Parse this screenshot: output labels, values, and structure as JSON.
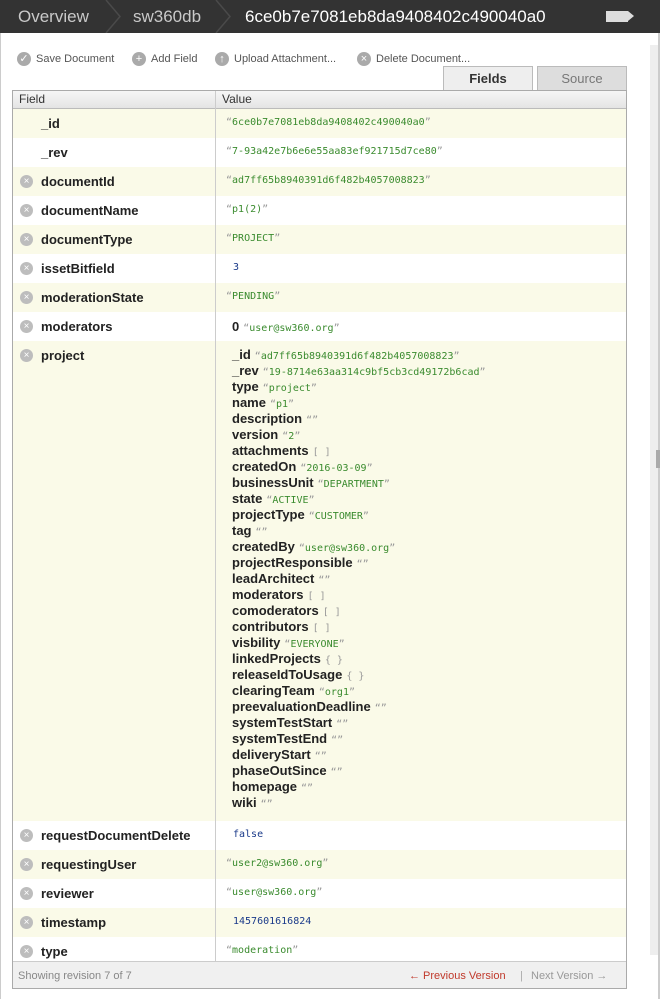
{
  "breadcrumb": {
    "overview": "Overview",
    "db": "sw360db",
    "doc": "6ce0b7e7081eb8da9408402c490040a0"
  },
  "toolbar": {
    "save": "Save Document",
    "add": "Add Field",
    "upload": "Upload Attachment...",
    "delete": "Delete Document..."
  },
  "tabs": {
    "fields": "Fields",
    "source": "Source"
  },
  "grid": {
    "col_field": "Field",
    "col_value": "Value"
  },
  "rows": [
    {
      "field": "_id",
      "value": "6ce0b7e7081eb8da9408402c490040a0",
      "type": "string",
      "deletable": false
    },
    {
      "field": "_rev",
      "value": "7-93a42e7b6e6e55aa83ef921715d7ce80",
      "type": "string",
      "deletable": false
    },
    {
      "field": "documentId",
      "value": "ad7ff65b8940391d6f482b4057008823",
      "type": "string",
      "deletable": true
    },
    {
      "field": "documentName",
      "value": "p1(2)",
      "type": "string",
      "deletable": true
    },
    {
      "field": "documentType",
      "value": "PROJECT",
      "type": "string",
      "deletable": true
    },
    {
      "field": "issetBitfield",
      "value": "3",
      "type": "number",
      "deletable": true
    },
    {
      "field": "moderationState",
      "value": "PENDING",
      "type": "string",
      "deletable": true
    },
    {
      "field": "moderators",
      "index": "0",
      "value": "user@sw360.org",
      "type": "array",
      "deletable": true
    },
    {
      "field": "project",
      "type": "object",
      "deletable": true
    },
    {
      "field": "requestDocumentDelete",
      "value": "false",
      "type": "bool",
      "deletable": true
    },
    {
      "field": "requestingUser",
      "value": "user2@sw360.org",
      "type": "string",
      "deletable": true
    },
    {
      "field": "reviewer",
      "value": "user@sw360.org",
      "type": "string",
      "deletable": true
    },
    {
      "field": "timestamp",
      "value": "1457601616824",
      "type": "number",
      "deletable": true
    },
    {
      "field": "type",
      "value": "moderation",
      "type": "string",
      "deletable": true
    }
  ],
  "project": [
    {
      "k": "_id",
      "v": "ad7ff65b8940391d6f482b4057008823",
      "t": "s"
    },
    {
      "k": "_rev",
      "v": "19-8714e63aa314c9bf5cb3cd49172b6cad",
      "t": "s"
    },
    {
      "k": "type",
      "v": "project",
      "t": "s"
    },
    {
      "k": "name",
      "v": "p1",
      "t": "s"
    },
    {
      "k": "description",
      "v": "",
      "t": "s"
    },
    {
      "k": "version",
      "v": "2",
      "t": "s"
    },
    {
      "k": "attachments",
      "v": "[ ]",
      "t": "b"
    },
    {
      "k": "createdOn",
      "v": "2016-03-09",
      "t": "s"
    },
    {
      "k": "businessUnit",
      "v": "DEPARTMENT",
      "t": "s"
    },
    {
      "k": "state",
      "v": "ACTIVE",
      "t": "s"
    },
    {
      "k": "projectType",
      "v": "CUSTOMER",
      "t": "s"
    },
    {
      "k": "tag",
      "v": "",
      "t": "s"
    },
    {
      "k": "createdBy",
      "v": "user@sw360.org",
      "t": "s"
    },
    {
      "k": "projectResponsible",
      "v": "",
      "t": "s"
    },
    {
      "k": "leadArchitect",
      "v": "",
      "t": "s"
    },
    {
      "k": "moderators",
      "v": "[ ]",
      "t": "b"
    },
    {
      "k": "comoderators",
      "v": "[ ]",
      "t": "b"
    },
    {
      "k": "contributors",
      "v": "[ ]",
      "t": "b"
    },
    {
      "k": "visbility",
      "v": "EVERYONE",
      "t": "s"
    },
    {
      "k": "linkedProjects",
      "v": "{ }",
      "t": "b"
    },
    {
      "k": "releaseIdToUsage",
      "v": "{ }",
      "t": "b"
    },
    {
      "k": "clearingTeam",
      "v": "org1",
      "t": "s"
    },
    {
      "k": "preevaluationDeadline",
      "v": "",
      "t": "s"
    },
    {
      "k": "systemTestStart",
      "v": "",
      "t": "s"
    },
    {
      "k": "systemTestEnd",
      "v": "",
      "t": "s"
    },
    {
      "k": "deliveryStart",
      "v": "",
      "t": "s"
    },
    {
      "k": "phaseOutSince",
      "v": "",
      "t": "s"
    },
    {
      "k": "homepage",
      "v": "",
      "t": "s"
    },
    {
      "k": "wiki",
      "v": "",
      "t": "s"
    }
  ],
  "footer": {
    "revision": "Showing revision 7 of 7",
    "prev": "← Previous Version",
    "sep": "|",
    "next": "Next Version →"
  }
}
